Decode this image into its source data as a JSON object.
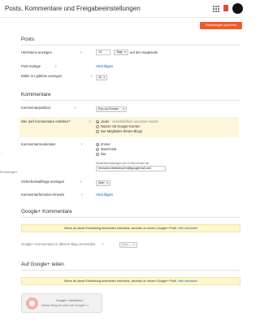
{
  "header": {
    "title": "Posts, Kommentare und Freigabeeinstellungen",
    "save_label": "Einstellungen speichern"
  },
  "posts": {
    "title": "Posts",
    "max_posts": {
      "label": "Höchstens anzeigen",
      "value": "14",
      "unit_select": "Tage",
      "suffix": "auf der Hauptseite"
    },
    "template": {
      "label": "Post-Vorlage",
      "link": "Hinzufügen"
    },
    "lightbox": {
      "label": "Bilder in Lightbox anzeigen",
      "value": "Ja"
    }
  },
  "comments": {
    "title": "Kommentare",
    "position": {
      "label": "Kommentarposition",
      "value": "Pop-up-Fenster"
    },
    "who": {
      "label": "Wer darf Kommentare erstellen?",
      "options": [
        "Jeder",
        "Nutzer mit Google-Konten",
        "Nur Mitglieder dieses Blogs"
      ],
      "hint": "- einschließlich anonyme Nutzer",
      "selected_index": 0
    },
    "moderation": {
      "label": "Kommentarmoderation",
      "options": [
        "Immer",
        "Manchmal",
        "Nie"
      ],
      "selected_index": 0,
      "email_label": "Moderationsanfragen per E-Mail senden an",
      "email_value": "bernardo.delabarquera@googlemail.com"
    },
    "security": {
      "label": "Sicherheitsabfrage anzeigen",
      "value": "Nein"
    },
    "form_message": {
      "label": "Kommentarformular-Hinweis",
      "link": "Hinzufügen"
    }
  },
  "gplus_comments": {
    "title": "Google+ Kommentare",
    "notice_text": "Wenn du diese Einstellung bearbeiten möchtest, wechsle zu einem Google+ Profil.",
    "notice_link": "Hier wechseln",
    "use_label": "Google+ Kommentare in diesem Blog verwenden",
    "use_value": "Nein"
  },
  "gplus_share": {
    "title": "Auf Google+ teilen",
    "notice_text": "Wenn du diese Einstellung bearbeiten möchtest, wechsle zu einem Google+ Profil.",
    "notice_link": "Hier wechseln",
    "box_title": "Google+ deaktiviert",
    "box_sub": "Dieser Blog ist nicht mit Google+ v"
  },
  "side": {
    "item1": "←",
    "item2": "Einstelungen"
  },
  "colors": {
    "accent": "#f05a28",
    "link": "#1155cc",
    "highlight": "#fdf6dc",
    "notice": "#fff6cc"
  }
}
